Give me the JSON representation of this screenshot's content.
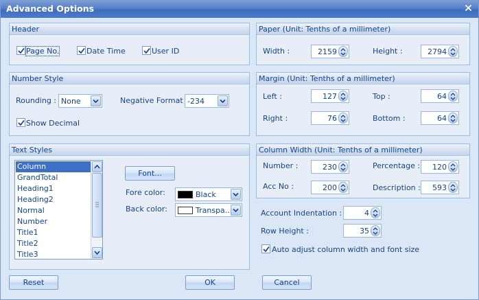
{
  "window": {
    "title": "Advanced Options"
  },
  "header_panel": {
    "title": "Header",
    "page_no": "Page No.",
    "date_time": "Date Time",
    "user_id": "User ID"
  },
  "paper_panel": {
    "title": "Paper (Unit: Tenths of a millimeter)",
    "width_label": "Width :",
    "width_value": "2159",
    "height_label": "Height :",
    "height_value": "2794"
  },
  "number_style": {
    "title": "Number Style",
    "rounding_label": "Rounding :",
    "rounding_value": "None",
    "negative_label": "Negative Format :",
    "negative_value": "-234",
    "show_decimal": "Show Decimal"
  },
  "margin_panel": {
    "title": "Margin (Unit: Tenths of a millimeter)",
    "left_label": "Left :",
    "left_value": "127",
    "top_label": "Top :",
    "top_value": "64",
    "right_label": "Right :",
    "right_value": "76",
    "bottom_label": "Bottom :",
    "bottom_value": "64"
  },
  "text_styles": {
    "title": "Text Styles",
    "items": [
      "Column",
      "GrandTotal",
      "Heading1",
      "Heading2",
      "Normal",
      "Number",
      "Title1",
      "Title2",
      "Title3"
    ],
    "font_button": "Font...",
    "fore_label": "Fore color:",
    "fore_value": "Black",
    "fore_color": "#000000",
    "back_label": "Back color:",
    "back_value": "Transpa...",
    "back_color": "#ffffff"
  },
  "column_width": {
    "title": "Column Width (Unit: Tenths of a millimeter)",
    "number_label": "Number :",
    "number_value": "230",
    "percentage_label": "Percentage :",
    "percentage_value": "120",
    "accno_label": "Acc No :",
    "accno_value": "200",
    "description_label": "Description :",
    "description_value": "593"
  },
  "extra": {
    "indent_label": "Account Indentation :",
    "indent_value": "4",
    "row_height_label": "Row Height :",
    "row_height_value": "35",
    "auto_adjust": "Auto adjust column width and font size"
  },
  "buttons": {
    "reset": "Reset",
    "ok": "OK",
    "cancel": "Cancel"
  },
  "colors": {
    "accent": "#15428b",
    "selection": "#3d6fc5",
    "titlebar": "#4d7ccb"
  }
}
